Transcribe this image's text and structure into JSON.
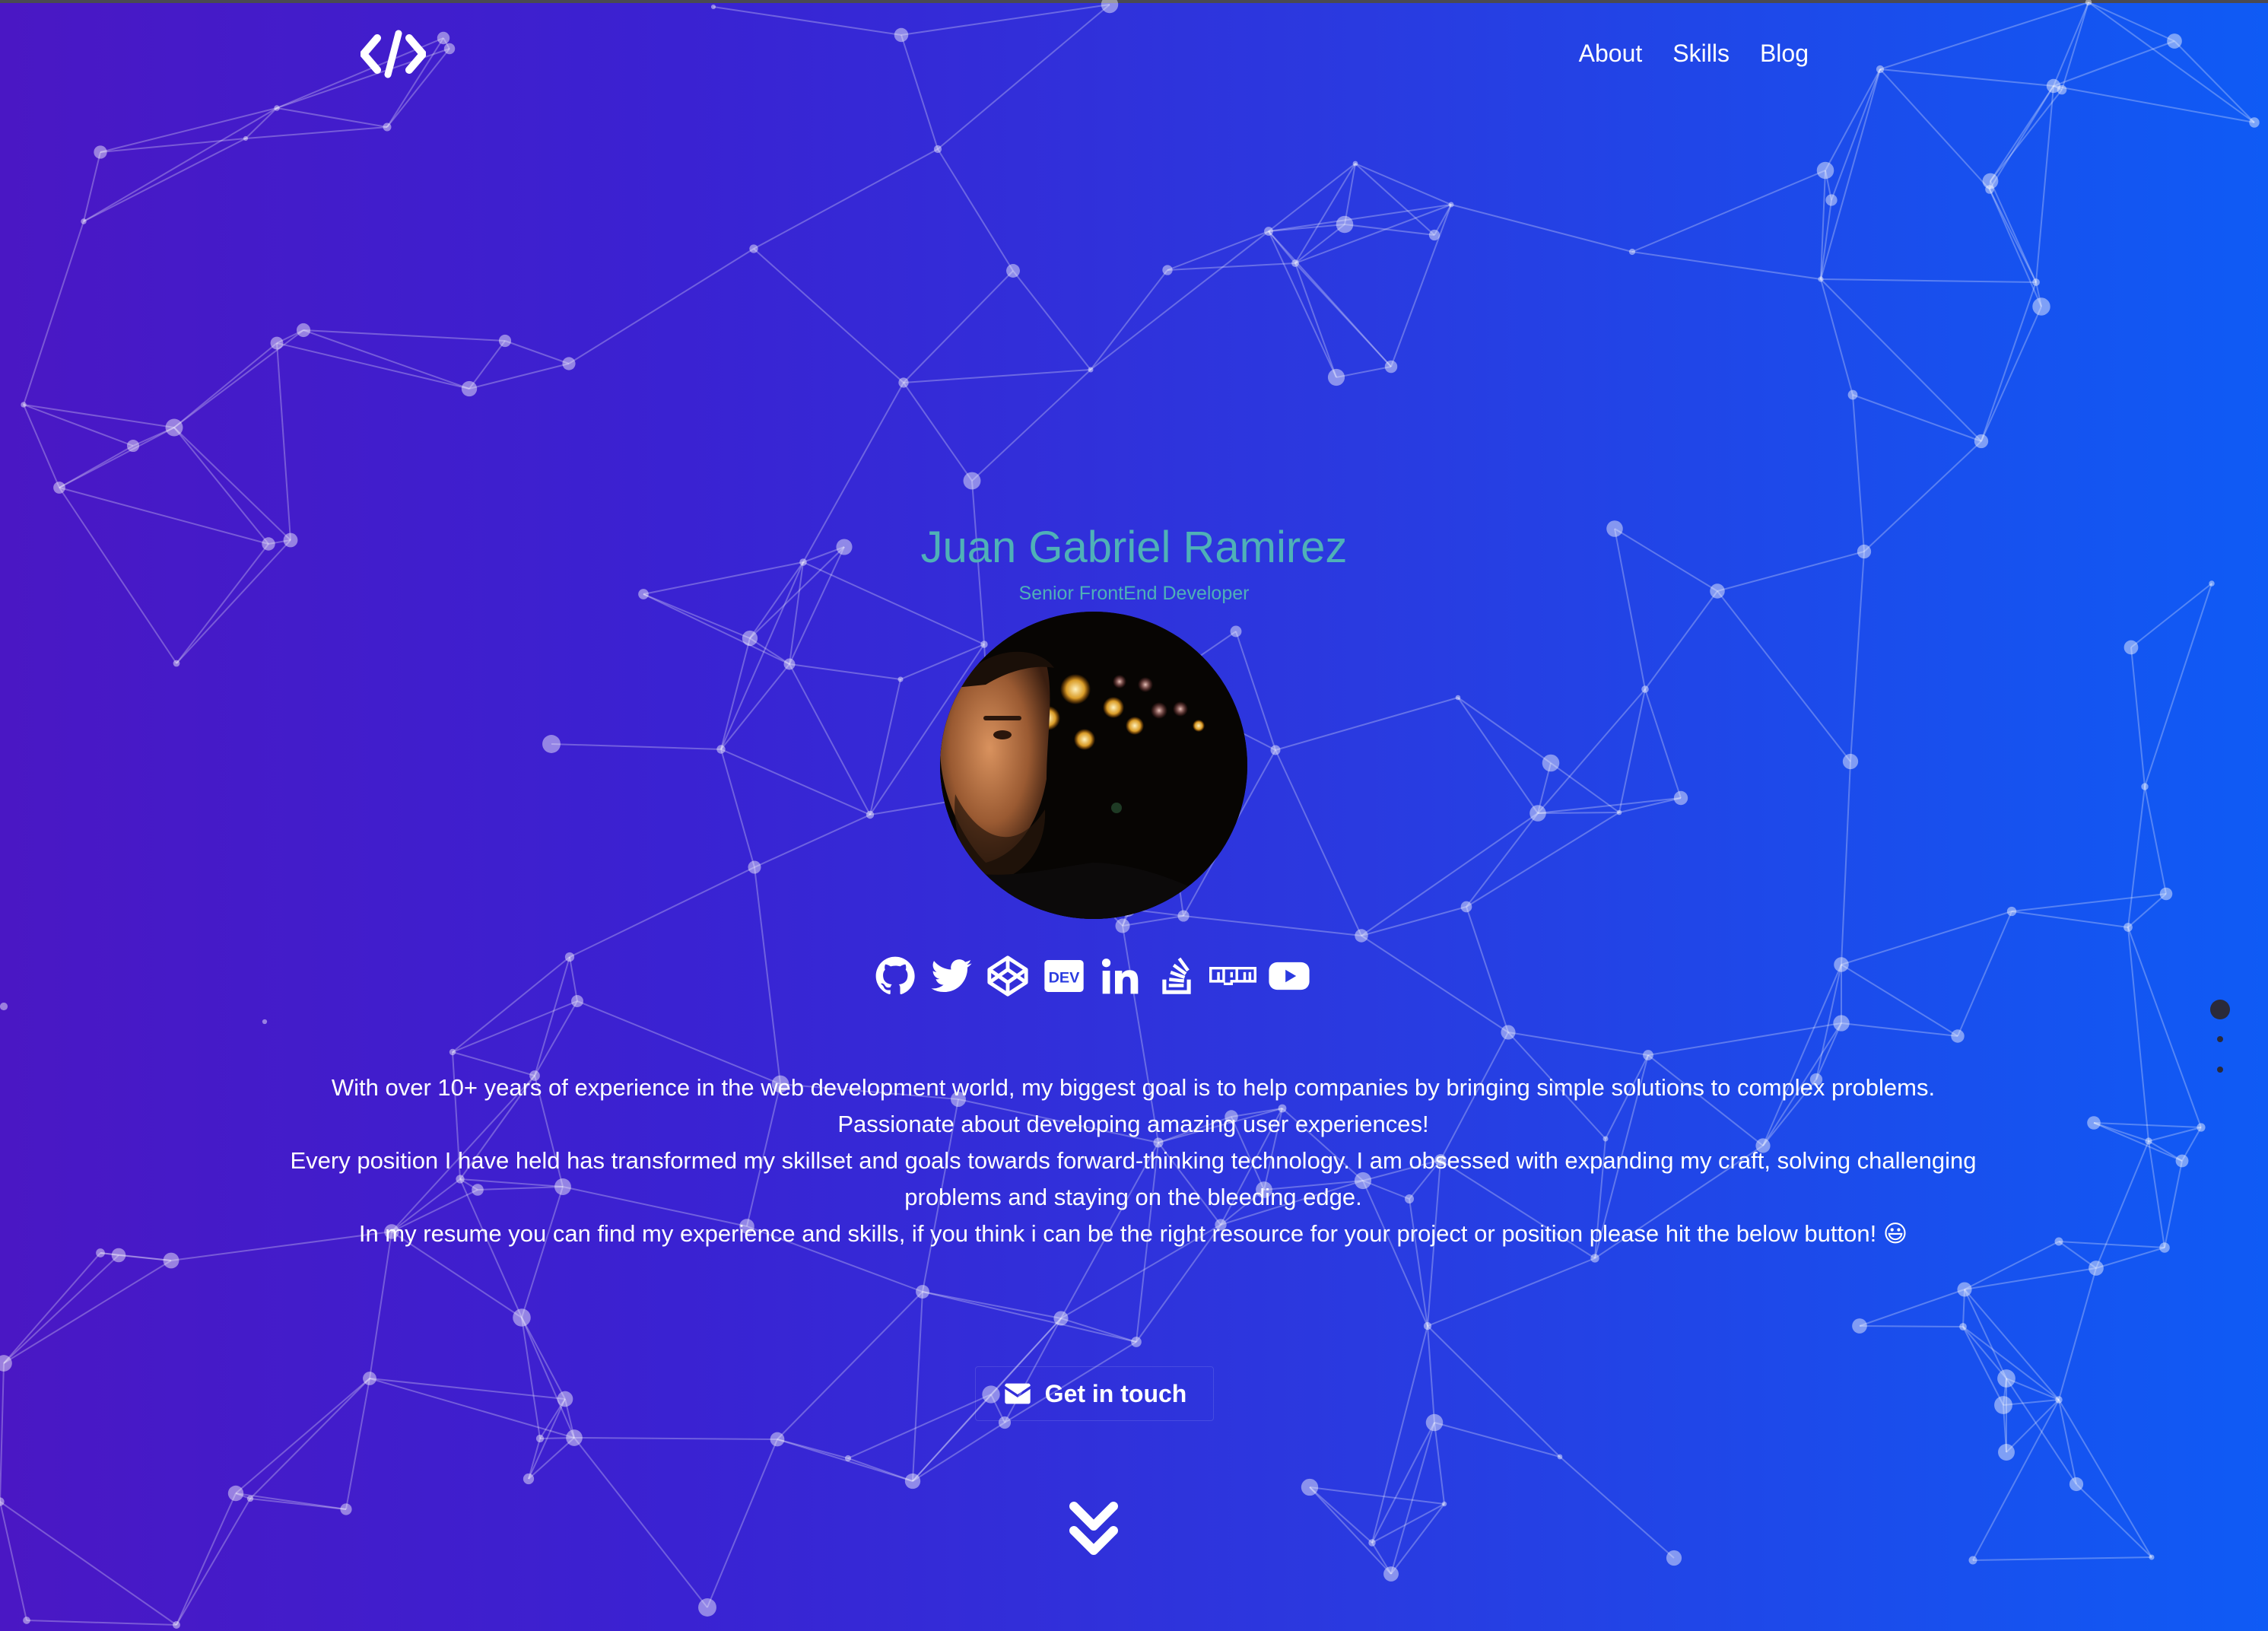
{
  "header": {
    "logo_icon": "code-brackets-icon",
    "nav": [
      {
        "label": "About"
      },
      {
        "label": "Skills"
      },
      {
        "label": "Blog"
      }
    ]
  },
  "hero": {
    "name": "Juan Gabriel Ramirez",
    "role": "Senior FrontEnd Developer",
    "avatar": "profile-photo",
    "socials": [
      {
        "icon": "github-icon",
        "label": "GitHub"
      },
      {
        "icon": "twitter-icon",
        "label": "Twitter"
      },
      {
        "icon": "codepen-icon",
        "label": "CodePen"
      },
      {
        "icon": "dev-icon",
        "label": "DEV"
      },
      {
        "icon": "linkedin-icon",
        "label": "LinkedIn"
      },
      {
        "icon": "stackoverflow-icon",
        "label": "Stack Overflow"
      },
      {
        "icon": "npm-icon",
        "label": "npm"
      },
      {
        "icon": "youtube-icon",
        "label": "YouTube"
      }
    ],
    "bio": [
      "With over 10+ years of experience in the web development world, my biggest goal is to help companies by bringing simple solutions to complex problems.",
      "Passionate about developing amazing user experiences!",
      "Every position I have held has transformed my skillset and goals towards forward-thinking technology. I am obsessed with expanding my craft, solving challenging problems and staying on the bleeding edge.",
      "In my resume you can find my experience and skills, if you think i can be the right resource for your project or position please hit the below button! 😃"
    ],
    "cta_label": "Get in touch",
    "cta_icon": "envelope-icon",
    "scroll_icon": "double-chevron-down-icon"
  },
  "pagination": {
    "dots": 3,
    "active_index": 0
  },
  "colors": {
    "gradient_start": "#4a17c4",
    "gradient_end": "#0f5bf5",
    "accent": "#4fb1b7",
    "text": "#ffffff"
  }
}
